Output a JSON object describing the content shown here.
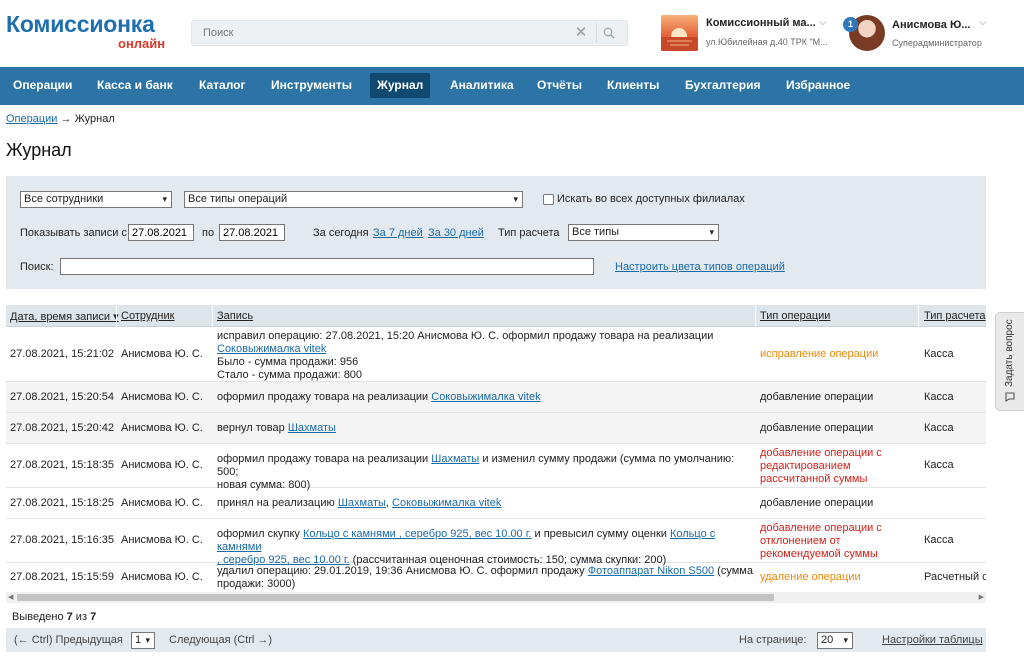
{
  "logo": {
    "main": "Комиссионка",
    "sub": "онлайн"
  },
  "search": {
    "placeholder": "Поиск"
  },
  "store": {
    "name": "Комиссионный ма...",
    "address": "ул.Юбилейная д.40 ТРК \"М..."
  },
  "user": {
    "name": "Анисмова Ю...",
    "role": "Суперадминистратор",
    "notifications": "1"
  },
  "nav": [
    "Операции",
    "Касса и банк",
    "Каталог",
    "Инструменты",
    "Журнал",
    "Аналитика",
    "Отчёты",
    "Клиенты",
    "Бухгалтерия",
    "Избранное"
  ],
  "breadcrumb": {
    "link": "Операции",
    "arrow": "→",
    "current": "Журнал"
  },
  "page_title": "Журнал",
  "filters": {
    "employees": "Все сотрудники",
    "op_types": "Все типы операций",
    "all_branches": "Искать во всех доступных филиалах",
    "show_from_label": "Показывать записи с",
    "date_from": "27.08.2021",
    "to_label": "по",
    "date_to": "27.08.2021",
    "today": "За сегодня",
    "week": "За 7 дней",
    "month": "За 30 дней",
    "calc_type_label": "Тип расчета",
    "calc_type": "Все типы",
    "search_label": "Поиск:",
    "colors_link": "Настроить цвета типов операций"
  },
  "table": {
    "headers": {
      "date": "Дата, время записи",
      "employee": "Сотрудник",
      "record": "Запись",
      "op_type": "Тип операции",
      "calc": "Тип расчета"
    },
    "rows": [
      {
        "date": "27.08.2021, 15:21:02",
        "employee": "Анисмова Ю. С.",
        "rec1": "исправил операцию: 27.08.2021, 15:20 Анисмова Ю. С. оформил продажу товара на реализации",
        "rec1_link": "Соковыжималка vitek",
        "rec2": "Было - сумма продажи: 956",
        "rec3": "Стало - сумма продажи: 800",
        "op_type": "исправление операции",
        "calc": "Касса"
      },
      {
        "date": "27.08.2021, 15:20:54",
        "employee": "Анисмова Ю. С.",
        "rec1": "оформил продажу товара на реализации ",
        "rec1_link": "Соковыжималка vitek",
        "op_type": "добавление операции",
        "calc": "Касса"
      },
      {
        "date": "27.08.2021, 15:20:42",
        "employee": "Анисмова Ю. С.",
        "rec1": "вернул товар ",
        "rec1_link": "Шахматы",
        "op_type": "добавление операции",
        "calc": "Касса"
      },
      {
        "date": "27.08.2021, 15:18:35",
        "employee": "Анисмова Ю. С.",
        "rec1": "оформил продажу товара на реализации ",
        "rec1_link": "Шахматы",
        "rec1_tail": " и изменил сумму продажи (сумма по умолчанию: 500;",
        "rec2": "новая сумма: 800)",
        "op_type": "добавление операции с редактированием рассчитанной суммы",
        "calc": "Касса"
      },
      {
        "date": "27.08.2021, 15:18:25",
        "employee": "Анисмова Ю. С.",
        "rec1": "принял на реализацию ",
        "rec1_link": "Шахматы",
        "rec1_sep": ", ",
        "rec1_link2": "Соковыжималка vitek",
        "op_type": "добавление операции",
        "calc": ""
      },
      {
        "date": "27.08.2021, 15:16:35",
        "employee": "Анисмова Ю. С.",
        "rec1": "оформил скупку ",
        "rec1_link": "Кольцо с камнями , серебро 925, вес 10.00 г.",
        "rec1_tail": " и превысил сумму оценки ",
        "rec1_link2": "Кольцо с камнями",
        "rec2_link": ", серебро 925, вес 10.00 г.",
        "rec2": " (рассчитанная оценочная стоимость: 150; сумма скупки: 200)",
        "op_type": "добавление операции с отклонением от рекомендуемой суммы",
        "calc": "Касса"
      },
      {
        "date": "27.08.2021, 15:15:59",
        "employee": "Анисмова Ю. С.",
        "rec1": "удалил операцию: 29.01.2019, 19:36 Анисмова Ю. С. оформил продажу ",
        "rec1_link": "Фотоаппарат Nikon S500",
        "rec1_tail": " (сумма",
        "rec2": "продажи: 3000)",
        "op_type": "удаление операции",
        "calc": "Расчетный сч"
      }
    ]
  },
  "count": {
    "label": "Выведено ",
    "shown": "7",
    "of": " из ",
    "total": "7"
  },
  "pager": {
    "prev": "(← Ctrl) Предыдущая",
    "page": "1",
    "next": "Следующая (Ctrl →)",
    "per_page_label": "На странице:",
    "per_page": "20",
    "settings": "Настройки таблицы"
  },
  "feedback": "Задать вопрос",
  "colors": {
    "nav": "#2c74a5",
    "nav_active": "#10496f",
    "link": "#1a6aa8",
    "orange": "#e78a0f",
    "red": "#d0221b"
  }
}
